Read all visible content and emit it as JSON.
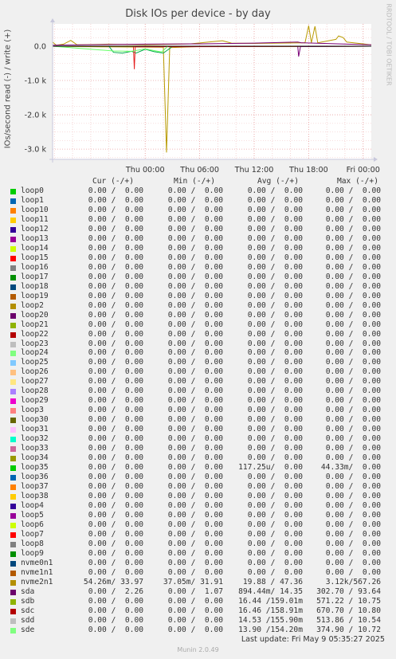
{
  "title": "Disk IOs per device - by day",
  "vertical_label": "IOs/second read (-) / write (+)",
  "watermark": "RRDTOOL / TOBI OETIKER",
  "legend_headers": {
    "cur": "Cur (-/+)",
    "min": "Min (-/+)",
    "avg": "Avg (-/+)",
    "max": "Max (-/+)"
  },
  "last_update": "Last update: Fri May  9 05:35:27 2025",
  "version": "Munin 2.0.49",
  "chart_data": {
    "type": "line",
    "title": "Disk IOs per device - by day",
    "ylabel": "IOs/second read (-) / write (+)",
    "ylim": [
      -3300,
      650
    ],
    "y_ticks": [
      0,
      -1000,
      -2000,
      -3000
    ],
    "y_tick_labels": [
      "0.0",
      "-1.0 k",
      "-2.0 k",
      "-3.0 k"
    ],
    "x_range_hours": [
      -10.2,
      24.9
    ],
    "x_ticks": [
      0,
      6,
      12,
      18,
      24
    ],
    "x_tick_labels": [
      "Thu 00:00",
      "Thu 06:00",
      "Thu 12:00",
      "Thu 18:00",
      "Fri 00:00"
    ],
    "grid": true,
    "series": [
      {
        "name": "nvme2n1",
        "color": "#B89A00",
        "read_points": [
          [
            -10.2,
            0
          ],
          [
            -8.5,
            -10
          ],
          [
            -4.5,
            -20
          ],
          [
            2,
            -30
          ],
          [
            2.35,
            -3100
          ],
          [
            2.7,
            -40
          ],
          [
            6,
            -10
          ],
          [
            12,
            -5
          ],
          [
            18,
            -10
          ],
          [
            24.9,
            0
          ]
        ],
        "write_points": [
          [
            -10.2,
            120
          ],
          [
            -9.8,
            30
          ],
          [
            -9,
            60
          ],
          [
            -8.2,
            170
          ],
          [
            -7.5,
            40
          ],
          [
            -4,
            60
          ],
          [
            0,
            40
          ],
          [
            5,
            70
          ],
          [
            8.5,
            160
          ],
          [
            9.5,
            90
          ],
          [
            12,
            80
          ],
          [
            17.6,
            100
          ],
          [
            18,
            600
          ],
          [
            18.3,
            100
          ],
          [
            18.7,
            580
          ],
          [
            19,
            100
          ],
          [
            21,
            200
          ],
          [
            21.3,
            300
          ],
          [
            21.8,
            250
          ],
          [
            22.2,
            120
          ],
          [
            24.9,
            40
          ]
        ]
      },
      {
        "name": "sdb",
        "color": "#00A84B",
        "read_points": [
          [
            -10.2,
            0
          ],
          [
            -4,
            0
          ],
          [
            -3.5,
            -180
          ],
          [
            -2.5,
            -200
          ],
          [
            -1.5,
            -150
          ],
          [
            -1,
            -200
          ],
          [
            0,
            -90
          ],
          [
            1,
            -160
          ],
          [
            2,
            -200
          ],
          [
            3,
            -10
          ],
          [
            24.9,
            0
          ]
        ],
        "write_points": []
      },
      {
        "name": "sdc",
        "color": "#E52222",
        "read_points": [
          [
            -10.2,
            0
          ],
          [
            -1.3,
            0
          ],
          [
            -1.2,
            -670
          ],
          [
            -1.1,
            -20
          ],
          [
            24.9,
            0
          ]
        ],
        "write_points": []
      },
      {
        "name": "sda",
        "color": "#7A0177",
        "read_points": [
          [
            -10.2,
            0
          ],
          [
            16.8,
            0
          ],
          [
            16.9,
            -300
          ],
          [
            17.1,
            -10
          ],
          [
            24.9,
            0
          ]
        ],
        "write_points": [
          [
            -10.2,
            30
          ],
          [
            0,
            60
          ],
          [
            6,
            70
          ],
          [
            12,
            90
          ],
          [
            16.8,
            120
          ],
          [
            17.2,
            100
          ],
          [
            24.9,
            40
          ]
        ]
      },
      {
        "name": "sde",
        "color": "#66FF66",
        "read_points": [
          [
            -10.2,
            0
          ],
          [
            -3.5,
            -140
          ],
          [
            -1.5,
            -150
          ],
          [
            0,
            -80
          ],
          [
            1.8,
            -170
          ],
          [
            2.5,
            0
          ],
          [
            24.9,
            0
          ]
        ],
        "write_points": []
      }
    ]
  },
  "rows": [
    {
      "name": "loop0",
      "color": "#00CC00",
      "cur": "0.00 /  0.00",
      "min": "0.00 /  0.00",
      "avg": "0.00 /  0.00",
      "max": "0.00 /  0.00"
    },
    {
      "name": "loop1",
      "color": "#0066B3",
      "cur": "0.00 /  0.00",
      "min": "0.00 /  0.00",
      "avg": "0.00 /  0.00",
      "max": "0.00 /  0.00"
    },
    {
      "name": "loop10",
      "color": "#FF8000",
      "cur": "0.00 /  0.00",
      "min": "0.00 /  0.00",
      "avg": "0.00 /  0.00",
      "max": "0.00 /  0.00"
    },
    {
      "name": "loop11",
      "color": "#FFCC00",
      "cur": "0.00 /  0.00",
      "min": "0.00 /  0.00",
      "avg": "0.00 /  0.00",
      "max": "0.00 /  0.00"
    },
    {
      "name": "loop12",
      "color": "#330099",
      "cur": "0.00 /  0.00",
      "min": "0.00 /  0.00",
      "avg": "0.00 /  0.00",
      "max": "0.00 /  0.00"
    },
    {
      "name": "loop13",
      "color": "#990099",
      "cur": "0.00 /  0.00",
      "min": "0.00 /  0.00",
      "avg": "0.00 /  0.00",
      "max": "0.00 /  0.00"
    },
    {
      "name": "loop14",
      "color": "#CCFF00",
      "cur": "0.00 /  0.00",
      "min": "0.00 /  0.00",
      "avg": "0.00 /  0.00",
      "max": "0.00 /  0.00"
    },
    {
      "name": "loop15",
      "color": "#FF0000",
      "cur": "0.00 /  0.00",
      "min": "0.00 /  0.00",
      "avg": "0.00 /  0.00",
      "max": "0.00 /  0.00"
    },
    {
      "name": "loop16",
      "color": "#808080",
      "cur": "0.00 /  0.00",
      "min": "0.00 /  0.00",
      "avg": "0.00 /  0.00",
      "max": "0.00 /  0.00"
    },
    {
      "name": "loop17",
      "color": "#008F00",
      "cur": "0.00 /  0.00",
      "min": "0.00 /  0.00",
      "avg": "0.00 /  0.00",
      "max": "0.00 /  0.00"
    },
    {
      "name": "loop18",
      "color": "#00487D",
      "cur": "0.00 /  0.00",
      "min": "0.00 /  0.00",
      "avg": "0.00 /  0.00",
      "max": "0.00 /  0.00"
    },
    {
      "name": "loop19",
      "color": "#B35A00",
      "cur": "0.00 /  0.00",
      "min": "0.00 /  0.00",
      "avg": "0.00 /  0.00",
      "max": "0.00 /  0.00"
    },
    {
      "name": "loop2",
      "color": "#B38F00",
      "cur": "0.00 /  0.00",
      "min": "0.00 /  0.00",
      "avg": "0.00 /  0.00",
      "max": "0.00 /  0.00"
    },
    {
      "name": "loop20",
      "color": "#6B006B",
      "cur": "0.00 /  0.00",
      "min": "0.00 /  0.00",
      "avg": "0.00 /  0.00",
      "max": "0.00 /  0.00"
    },
    {
      "name": "loop21",
      "color": "#8FB300",
      "cur": "0.00 /  0.00",
      "min": "0.00 /  0.00",
      "avg": "0.00 /  0.00",
      "max": "0.00 /  0.00"
    },
    {
      "name": "loop22",
      "color": "#B30000",
      "cur": "0.00 /  0.00",
      "min": "0.00 /  0.00",
      "avg": "0.00 /  0.00",
      "max": "0.00 /  0.00"
    },
    {
      "name": "loop23",
      "color": "#BEBEBE",
      "cur": "0.00 /  0.00",
      "min": "0.00 /  0.00",
      "avg": "0.00 /  0.00",
      "max": "0.00 /  0.00"
    },
    {
      "name": "loop24",
      "color": "#80FF80",
      "cur": "0.00 /  0.00",
      "min": "0.00 /  0.00",
      "avg": "0.00 /  0.00",
      "max": "0.00 /  0.00"
    },
    {
      "name": "loop25",
      "color": "#80C9FF",
      "cur": "0.00 /  0.00",
      "min": "0.00 /  0.00",
      "avg": "0.00 /  0.00",
      "max": "0.00 /  0.00"
    },
    {
      "name": "loop26",
      "color": "#FFC080",
      "cur": "0.00 /  0.00",
      "min": "0.00 /  0.00",
      "avg": "0.00 /  0.00",
      "max": "0.00 /  0.00"
    },
    {
      "name": "loop27",
      "color": "#FFE680",
      "cur": "0.00 /  0.00",
      "min": "0.00 /  0.00",
      "avg": "0.00 /  0.00",
      "max": "0.00 /  0.00"
    },
    {
      "name": "loop28",
      "color": "#AA80FF",
      "cur": "0.00 /  0.00",
      "min": "0.00 /  0.00",
      "avg": "0.00 /  0.00",
      "max": "0.00 /  0.00"
    },
    {
      "name": "loop29",
      "color": "#EE00CC",
      "cur": "0.00 /  0.00",
      "min": "0.00 /  0.00",
      "avg": "0.00 /  0.00",
      "max": "0.00 /  0.00"
    },
    {
      "name": "loop3",
      "color": "#FF8080",
      "cur": "0.00 /  0.00",
      "min": "0.00 /  0.00",
      "avg": "0.00 /  0.00",
      "max": "0.00 /  0.00"
    },
    {
      "name": "loop30",
      "color": "#666600",
      "cur": "0.00 /  0.00",
      "min": "0.00 /  0.00",
      "avg": "0.00 /  0.00",
      "max": "0.00 /  0.00"
    },
    {
      "name": "loop31",
      "color": "#FFBFFF",
      "cur": "0.00 /  0.00",
      "min": "0.00 /  0.00",
      "avg": "0.00 /  0.00",
      "max": "0.00 /  0.00"
    },
    {
      "name": "loop32",
      "color": "#00FFCC",
      "cur": "0.00 /  0.00",
      "min": "0.00 /  0.00",
      "avg": "0.00 /  0.00",
      "max": "0.00 /  0.00"
    },
    {
      "name": "loop33",
      "color": "#CC6699",
      "cur": "0.00 /  0.00",
      "min": "0.00 /  0.00",
      "avg": "0.00 /  0.00",
      "max": "0.00 /  0.00"
    },
    {
      "name": "loop34",
      "color": "#999900",
      "cur": "0.00 /  0.00",
      "min": "0.00 /  0.00",
      "avg": "0.00 /  0.00",
      "max": "0.00 /  0.00"
    },
    {
      "name": "loop35",
      "color": "#00CC00",
      "cur": "0.00 /  0.00",
      "min": "0.00 /  0.00",
      "avg": "117.25u/  0.00",
      "max": "44.33m/  0.00"
    },
    {
      "name": "loop36",
      "color": "#0066B3",
      "cur": "0.00 /  0.00",
      "min": "0.00 /  0.00",
      "avg": "0.00 /  0.00",
      "max": "0.00 /  0.00"
    },
    {
      "name": "loop37",
      "color": "#FF8000",
      "cur": "0.00 /  0.00",
      "min": "0.00 /  0.00",
      "avg": "0.00 /  0.00",
      "max": "0.00 /  0.00"
    },
    {
      "name": "loop38",
      "color": "#FFCC00",
      "cur": "0.00 /  0.00",
      "min": "0.00 /  0.00",
      "avg": "0.00 /  0.00",
      "max": "0.00 /  0.00"
    },
    {
      "name": "loop4",
      "color": "#330099",
      "cur": "0.00 /  0.00",
      "min": "0.00 /  0.00",
      "avg": "0.00 /  0.00",
      "max": "0.00 /  0.00"
    },
    {
      "name": "loop5",
      "color": "#990099",
      "cur": "0.00 /  0.00",
      "min": "0.00 /  0.00",
      "avg": "0.00 /  0.00",
      "max": "0.00 /  0.00"
    },
    {
      "name": "loop6",
      "color": "#CCFF00",
      "cur": "0.00 /  0.00",
      "min": "0.00 /  0.00",
      "avg": "0.00 /  0.00",
      "max": "0.00 /  0.00"
    },
    {
      "name": "loop7",
      "color": "#FF0000",
      "cur": "0.00 /  0.00",
      "min": "0.00 /  0.00",
      "avg": "0.00 /  0.00",
      "max": "0.00 /  0.00"
    },
    {
      "name": "loop8",
      "color": "#808080",
      "cur": "0.00 /  0.00",
      "min": "0.00 /  0.00",
      "avg": "0.00 /  0.00",
      "max": "0.00 /  0.00"
    },
    {
      "name": "loop9",
      "color": "#008F00",
      "cur": "0.00 /  0.00",
      "min": "0.00 /  0.00",
      "avg": "0.00 /  0.00",
      "max": "0.00 /  0.00"
    },
    {
      "name": "nvme0n1",
      "color": "#00487D",
      "cur": "0.00 /  0.00",
      "min": "0.00 /  0.00",
      "avg": "0.00 /  0.00",
      "max": "0.00 /  0.00"
    },
    {
      "name": "nvme1n1",
      "color": "#B35A00",
      "cur": "0.00 /  0.00",
      "min": "0.00 /  0.00",
      "avg": "0.00 /  0.00",
      "max": "0.00 /  0.00"
    },
    {
      "name": "nvme2n1",
      "color": "#B38F00",
      "cur": "54.26m/ 33.97",
      "min": "37.05m/ 31.91",
      "avg": "19.88 / 47.36",
      "max": "3.12k/567.26"
    },
    {
      "name": "sda",
      "color": "#6B006B",
      "cur": "0.00 /  2.26",
      "min": "0.00 /  1.07",
      "avg": "894.44m/ 14.35",
      "max": "302.70 / 93.64"
    },
    {
      "name": "sdb",
      "color": "#8FB300",
      "cur": "0.00 /  0.00",
      "min": "0.00 /  0.00",
      "avg": "16.44 /159.01m",
      "max": "571.22 / 10.75"
    },
    {
      "name": "sdc",
      "color": "#B30000",
      "cur": "0.00 /  0.00",
      "min": "0.00 /  0.00",
      "avg": "16.46 /158.91m",
      "max": "670.70 / 10.80"
    },
    {
      "name": "sdd",
      "color": "#BEBEBE",
      "cur": "0.00 /  0.00",
      "min": "0.00 /  0.00",
      "avg": "14.53 /155.90m",
      "max": "513.86 / 10.54"
    },
    {
      "name": "sde",
      "color": "#80FF80",
      "cur": "0.00 /  0.00",
      "min": "0.00 /  0.00",
      "avg": "13.90 /154.20m",
      "max": "374.90 / 10.72"
    }
  ]
}
